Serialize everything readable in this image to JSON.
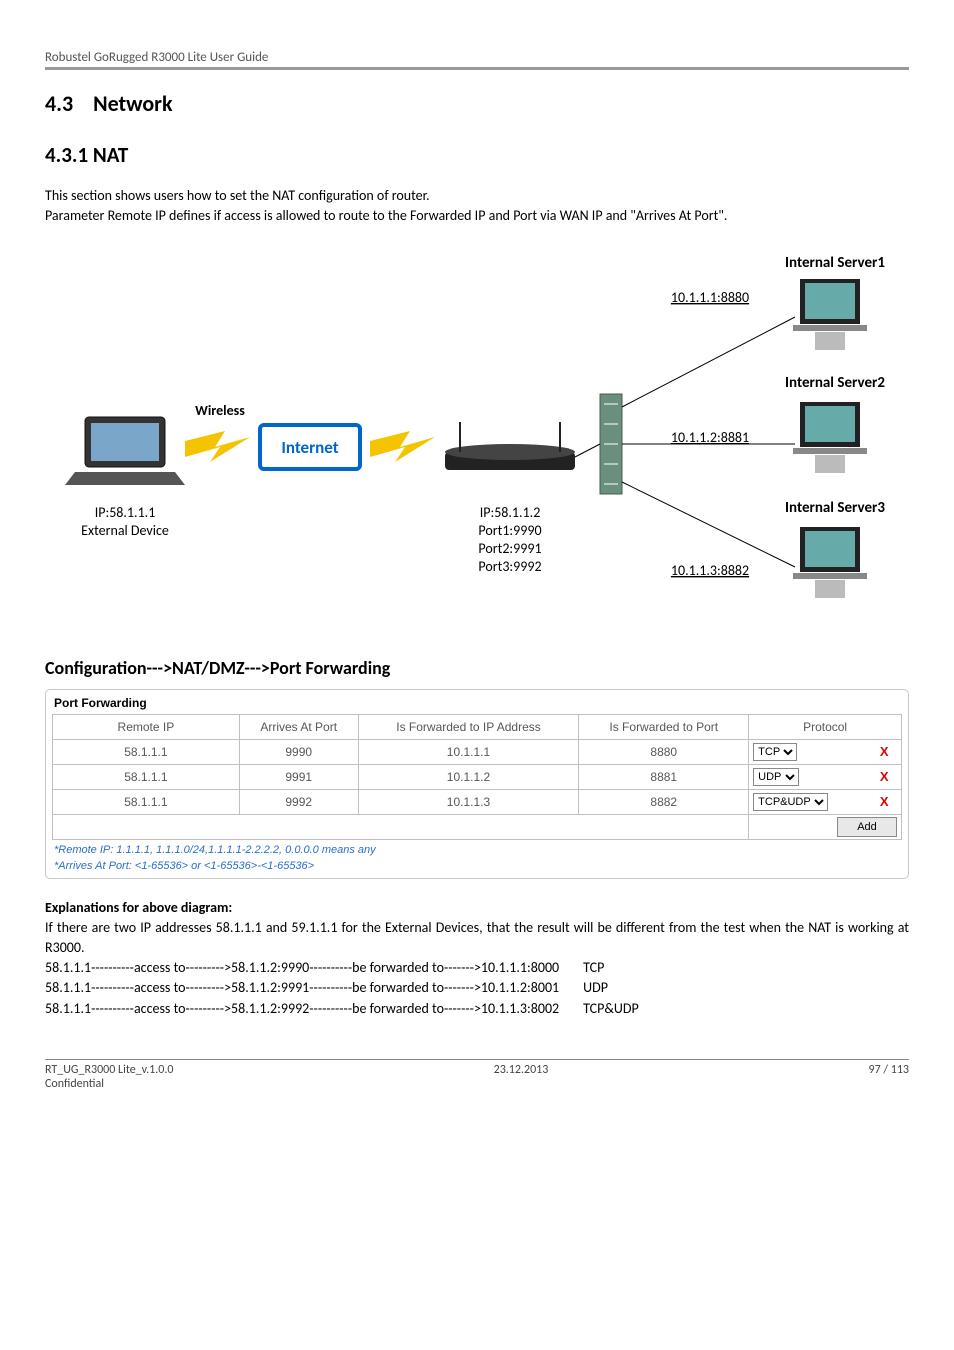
{
  "header": {
    "product": "Robustel GoRugged R3000 Lite User Guide"
  },
  "section": {
    "num": "4.3",
    "title": "Network",
    "sub_num": "4.3.1",
    "sub_title": "NAT"
  },
  "intro": {
    "p1": "This section shows users how to set the NAT configuration of router.",
    "p2": "Parameter Remote IP defines if access is allowed to route to the Forwarded IP and Port via WAN IP and \"Arrives At Port\"."
  },
  "diagram": {
    "wireless": "Wireless",
    "internet": "Internet",
    "ext_ip": "IP:58.1.1.1",
    "ext_label": "External Device",
    "router_ip": "IP:58.1.1.2",
    "port1": "Port1:9990",
    "port2": "Port2:9991",
    "port3": "Port3:9992",
    "srv1_label": "Internal Server1",
    "srv1_ip": "10.1.1.1:8880",
    "srv2_label": "Internal Server2",
    "srv2_ip": "10.1.1.2:8881",
    "srv3_label": "Internal Server3",
    "srv3_ip": "10.1.1.3:8882"
  },
  "config": {
    "heading": "Configuration--->NAT/DMZ--->Port Forwarding"
  },
  "table": {
    "title": "Port Forwarding",
    "cols": {
      "remote_ip": "Remote IP",
      "arrives": "Arrives At Port",
      "fwd_ip": "Is Forwarded to IP Address",
      "fwd_port": "Is Forwarded to Port",
      "proto": "Protocol"
    },
    "rows": [
      {
        "remote_ip": "58.1.1.1",
        "arrives": "9990",
        "fwd_ip": "10.1.1.1",
        "fwd_port": "8880",
        "proto": "TCP"
      },
      {
        "remote_ip": "58.1.1.1",
        "arrives": "9991",
        "fwd_ip": "10.1.1.2",
        "fwd_port": "8881",
        "proto": "UDP"
      },
      {
        "remote_ip": "58.1.1.1",
        "arrives": "9992",
        "fwd_ip": "10.1.1.3",
        "fwd_port": "8882",
        "proto": "TCP&UDP"
      }
    ],
    "note1": "*Remote IP: 1.1.1.1, 1.1.1.0/24,1.1.1.1-2.2.2.2, 0.0.0.0 means any",
    "note2": "*Arrives At Port: <1-65536> or <1-65536>-<1-65536>",
    "add": "Add"
  },
  "explain": {
    "heading": "Explanations for above diagram:",
    "intro": "If there are two IP addresses 58.1.1.1 and 59.1.1.1 for the External Devices, that the result will be different from the test when the NAT is working at R3000.",
    "lines": [
      {
        "flow": "58.1.1.1----------access to--------->58.1.1.2:9990----------be forwarded to------->10.1.1.1:8000",
        "proto": "TCP"
      },
      {
        "flow": "58.1.1.1----------access to--------->58.1.1.2:9991----------be forwarded to------->10.1.1.2:8001",
        "proto": "UDP"
      },
      {
        "flow": "58.1.1.1----------access to--------->58.1.1.2:9992----------be forwarded to------->10.1.1.3:8002",
        "proto": "TCP&UDP"
      }
    ]
  },
  "footer": {
    "doc": "RT_UG_R3000 Lite_v.1.0.0",
    "conf": "Confidential",
    "date": "23.12.2013",
    "page": "97 / 113"
  }
}
